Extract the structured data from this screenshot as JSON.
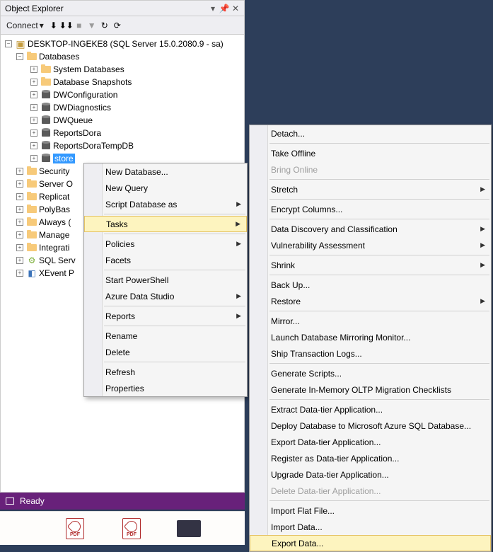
{
  "panel": {
    "title": "Object Explorer"
  },
  "toolbar": {
    "connect": "Connect"
  },
  "tree": {
    "server": "DESKTOP-INGEKE8 (SQL Server 15.0.2080.9 - sa)",
    "databases": "Databases",
    "sysdb": "System Databases",
    "snap": "Database Snapshots",
    "dwconfig": "DWConfiguration",
    "dwdiag": "DWDiagnostics",
    "dwqueue": "DWQueue",
    "rdora": "ReportsDora",
    "rdoratmp": "ReportsDoraTempDB",
    "store": "store",
    "security": "Security",
    "serverobj": "Server O",
    "replic": "Replicat",
    "polybase": "PolyBas",
    "always": "Always (",
    "manage": "Manage",
    "integrat": "Integrati",
    "sqlserv": "SQL Serv",
    "xevent": "XEvent P"
  },
  "menu1": {
    "newdb": "New Database...",
    "newq": "New Query",
    "scriptdb": "Script Database as",
    "tasks": "Tasks",
    "policies": "Policies",
    "facets": "Facets",
    "startps": "Start PowerShell",
    "ads": "Azure Data Studio",
    "reports": "Reports",
    "rename": "Rename",
    "delete": "Delete",
    "refresh": "Refresh",
    "props": "Properties"
  },
  "menu2": {
    "detach": "Detach...",
    "offline": "Take Offline",
    "online": "Bring Online",
    "stretch": "Stretch",
    "encrypt": "Encrypt Columns...",
    "datadisc": "Data Discovery and Classification",
    "vuln": "Vulnerability Assessment",
    "shrink": "Shrink",
    "backup": "Back Up...",
    "restore": "Restore",
    "mirror": "Mirror...",
    "launchdbmm": "Launch Database Mirroring Monitor...",
    "shiptx": "Ship Transaction Logs...",
    "genscripts": "Generate Scripts...",
    "genimoltp": "Generate In-Memory OLTP Migration Checklists",
    "extdta": "Extract Data-tier Application...",
    "deployaz": "Deploy Database to Microsoft Azure SQL Database...",
    "expdta": "Export Data-tier Application...",
    "regdta": "Register as Data-tier Application...",
    "updta": "Upgrade Data-tier Application...",
    "deldta": "Delete Data-tier Application...",
    "impflat": "Import Flat File...",
    "impdata": "Import Data...",
    "expdata": "Export Data..."
  },
  "status": {
    "ready": "Ready"
  }
}
